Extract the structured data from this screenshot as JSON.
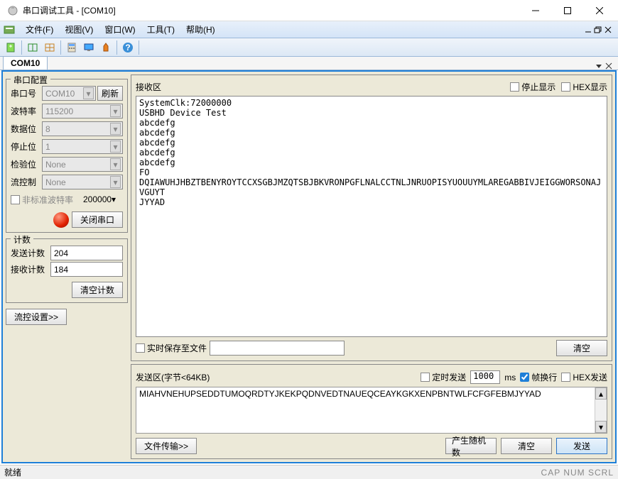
{
  "window": {
    "title": "串口调试工具 - [COM10]"
  },
  "menu": {
    "file": "文件(F)",
    "view": "视图(V)",
    "window": "窗口(W)",
    "tool": "工具(T)",
    "help": "帮助(H)"
  },
  "tab": {
    "label": "COM10"
  },
  "port_cfg": {
    "title": "串口配置",
    "port_lbl": "串口号",
    "port_val": "COM10",
    "refresh": "刷新",
    "baud_lbl": "波特率",
    "baud_val": "115200",
    "data_lbl": "数据位",
    "data_val": "8",
    "stop_lbl": "停止位",
    "stop_val": "1",
    "parity_lbl": "检验位",
    "parity_val": "None",
    "flow_lbl": "流控制",
    "flow_val": "None",
    "nonstd_lbl": "非标准波特率",
    "nonstd_val": "200000",
    "close_btn": "关闭串口"
  },
  "counter": {
    "title": "计数",
    "send_lbl": "发送计数",
    "send_val": "204",
    "recv_lbl": "接收计数",
    "recv_val": "184",
    "clear_btn": "清空计数"
  },
  "flow_btn": "流控设置>>",
  "recv": {
    "title": "接收区",
    "stop_disp": "停止显示",
    "hex_disp": "HEX显示",
    "content": "SystemClk:72000000\nUSBHD Device Test\nabcdefg\nabcdefg\nabcdefg\nabcdefg\nabcdefg\nFO\nDQIAWUHJHBZTBENYROYTCCXSGBJMZQTSBJBKVRONPGFLNALCCTNLJNRUOPISYUOUUYMLAREGABBIVJEIGGWORSONAJVGUYT\nJYYAD",
    "save_lbl": "实时保存至文件",
    "clear_btn": "清空"
  },
  "send": {
    "title": "发送区(字节<64KB)",
    "timed_lbl": "定时发送",
    "interval": "1000",
    "ms": "ms",
    "wrap_lbl": "帧换行",
    "hex_lbl": "HEX发送",
    "content": "MIAHVNEHUPSEDDTUMOQRDTYJKEKPQDNVEDTNAUEQCEAYKGKXENPBNTWLFCFGFEBMJYYAD",
    "file_btn": "文件传输>>",
    "rand_btn": "产生随机数",
    "clear_btn": "清空",
    "send_btn": "发送"
  },
  "status": {
    "ready": "就绪",
    "indicators": "CAP NUM SCRL"
  }
}
